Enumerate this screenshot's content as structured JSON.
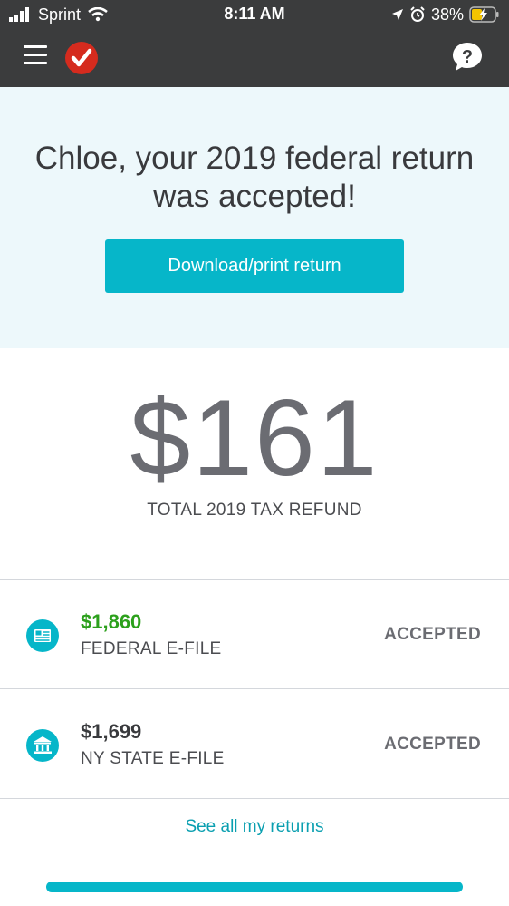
{
  "status_bar": {
    "carrier": "Sprint",
    "time": "8:11 AM",
    "battery_percent": "38%"
  },
  "hero": {
    "title_line1": "Chloe, your 2019 federal return",
    "title_line2": "was accepted!",
    "download_button": "Download/print return"
  },
  "refund": {
    "amount": "$161",
    "label": "TOTAL 2019 TAX REFUND"
  },
  "returns": [
    {
      "amount": "$1,860",
      "name": "FEDERAL E-FILE",
      "status": "ACCEPTED",
      "amount_color": "#2ca01c",
      "icon": "flag-icon"
    },
    {
      "amount": "$1,699",
      "name": "NY STATE E-FILE",
      "status": "ACCEPTED",
      "amount_color": "#393a3d",
      "icon": "state-building-icon"
    }
  ],
  "see_all_link": "See all my returns",
  "colors": {
    "accent": "#06b6c9",
    "topbar": "#3b3c3d",
    "hero_bg": "#edf8fb",
    "logo": "#d52b1e"
  }
}
